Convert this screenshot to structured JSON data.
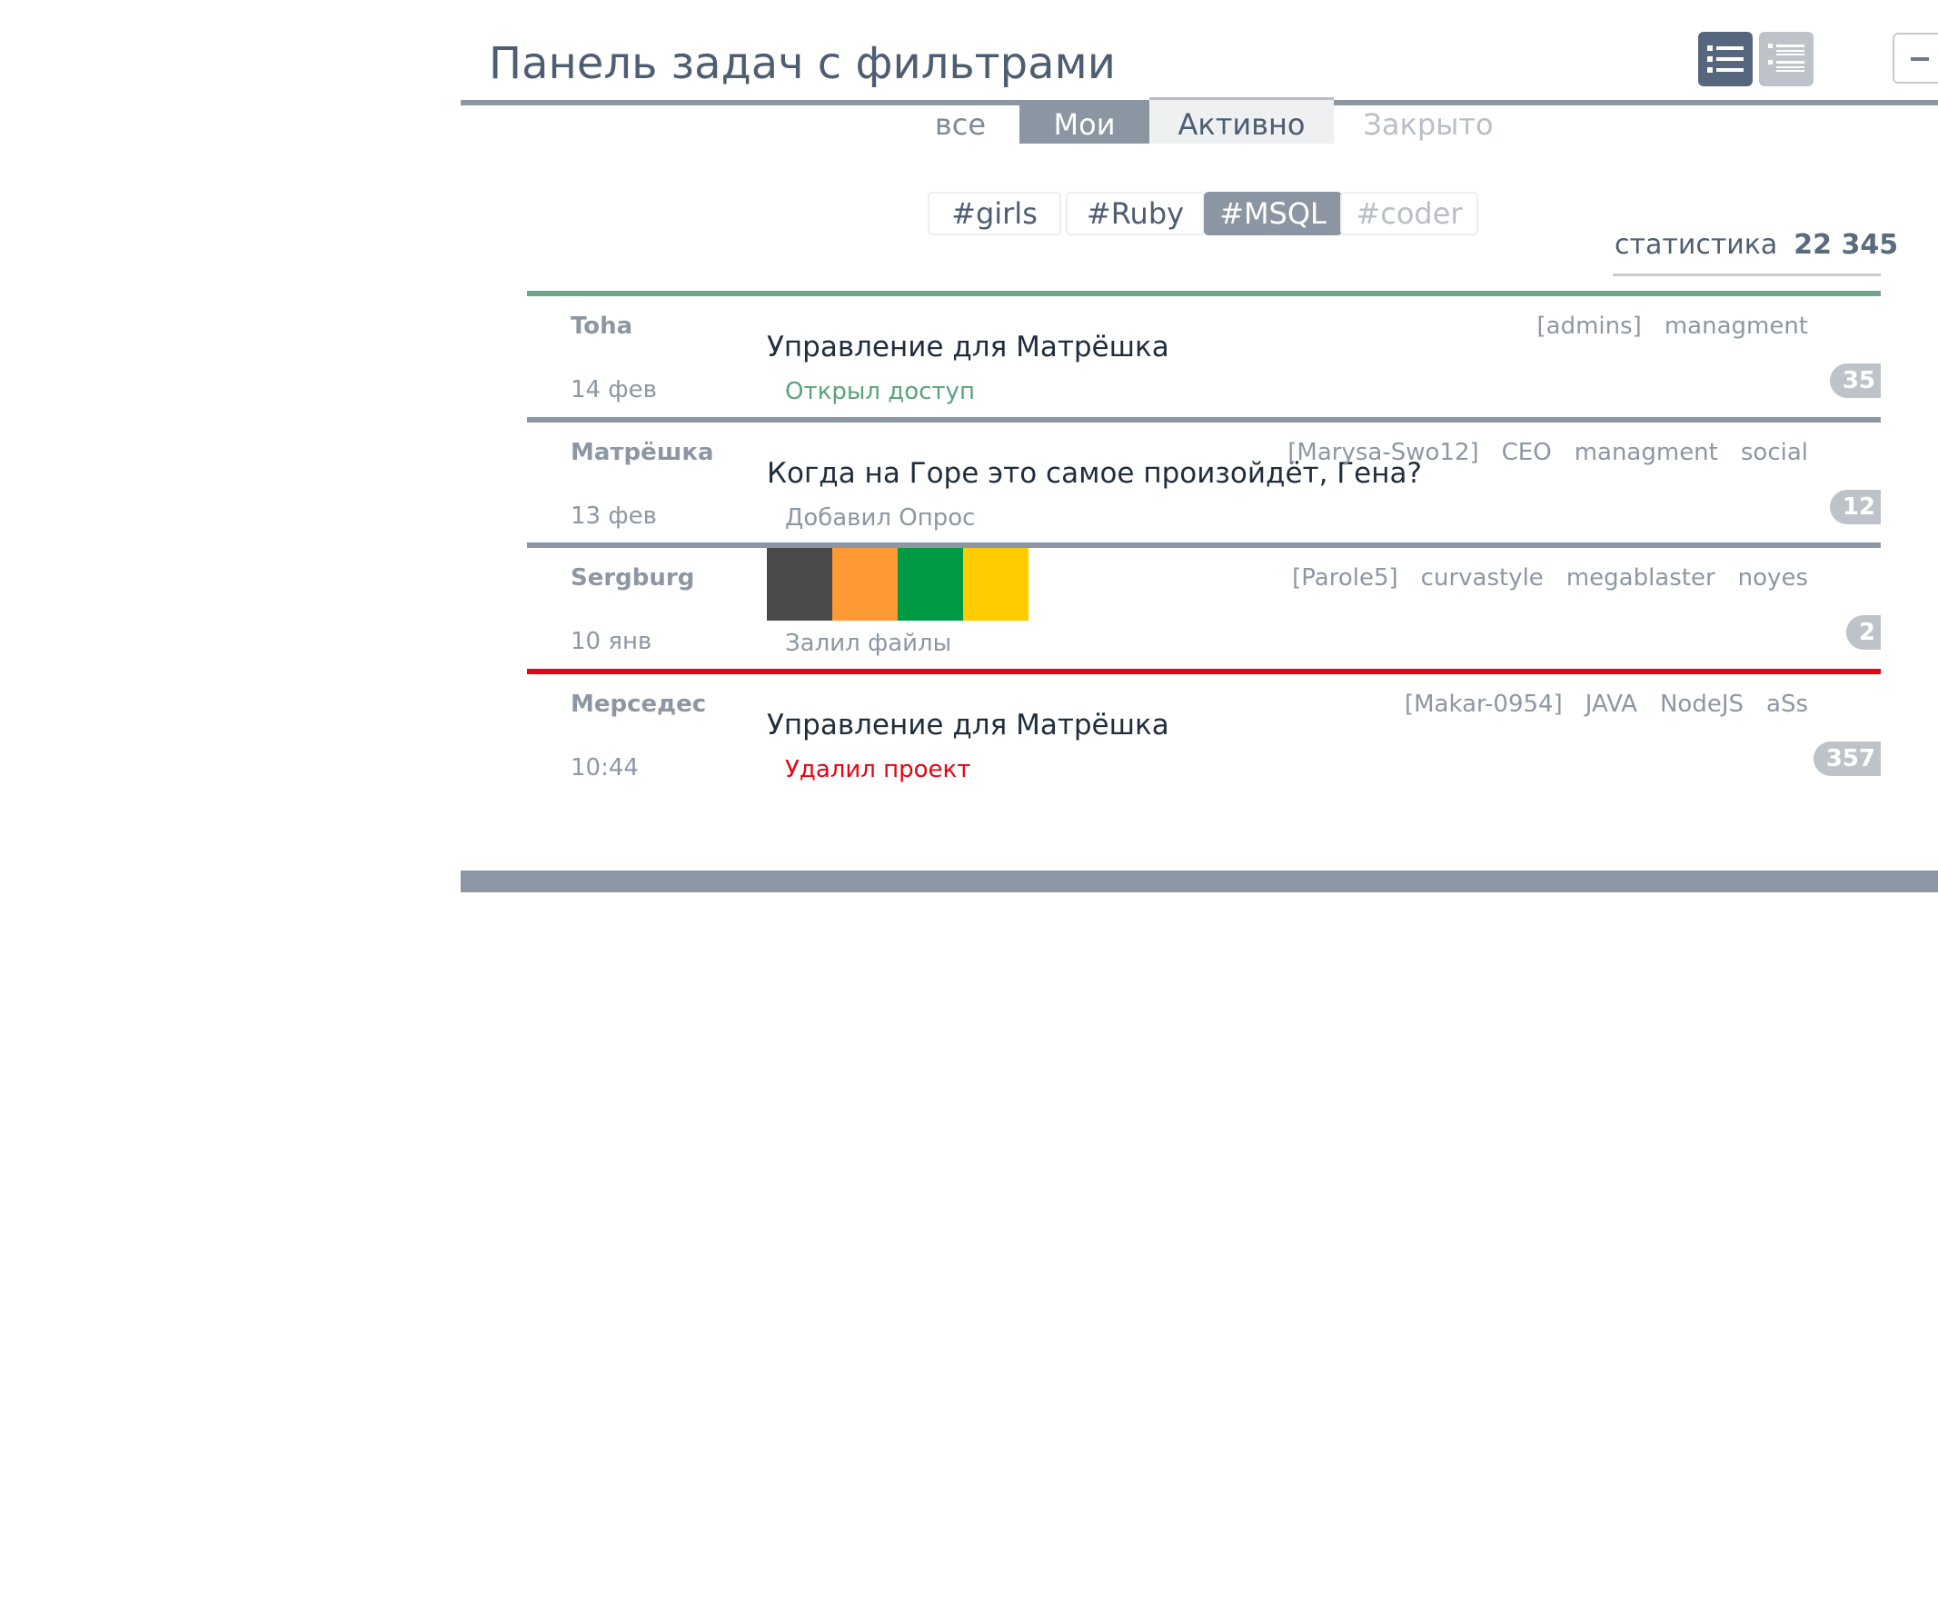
{
  "header": {
    "title": "Панель задач с фильтрами",
    "icons": {
      "list_view": "list-icon",
      "detail_view": "detail-list-icon",
      "minimize": "minus-icon"
    }
  },
  "status_tabs": [
    {
      "label": "все",
      "state": "default"
    },
    {
      "label": "Мои",
      "state": "selected"
    },
    {
      "label": "Активно",
      "state": "highlighted"
    },
    {
      "label": "Закрыто",
      "state": "disabled"
    }
  ],
  "hashtags": [
    {
      "label": "#girls",
      "state": "default"
    },
    {
      "label": "#Ruby",
      "state": "default"
    },
    {
      "label": "#MSQL",
      "state": "selected"
    },
    {
      "label": "#coder",
      "state": "disabled"
    }
  ],
  "stats": {
    "label": "статистика",
    "value": "22 345"
  },
  "tasks": [
    {
      "author": "Toha",
      "date": "14 фев",
      "title": "Управление для Матрёшка",
      "action": "Открыл доступ",
      "action_color": "#5aa27c",
      "line_color": "#6aa88a",
      "tags": [
        "[admins]",
        "managment"
      ],
      "count": "35"
    },
    {
      "author": "Матрёшка",
      "date": "13 фев",
      "title": "Когда на Горе это самое произойдёт, Гена?",
      "action": "Добавил Опрос",
      "action_color": "#8d97a3",
      "line_color": "#8d97a3",
      "tags": [
        "[Marysa-Swo12]",
        "CEO",
        "managment",
        "social"
      ],
      "count": "12"
    },
    {
      "author": "Sergburg",
      "date": "10 янв",
      "title": "",
      "action": "Залил файлы",
      "action_color": "#8d97a3",
      "line_color": "#8d97a3",
      "swatches": [
        "#4a4a4a",
        "#ff9933",
        "#009944",
        "#ffcc00"
      ],
      "tags": [
        "[Parole5]",
        "curvastyle",
        "megablaster",
        "noyes"
      ],
      "count": "2"
    },
    {
      "author": "Мерседес",
      "date": "10:44",
      "title": "Управление для Матрёшка",
      "action": "Удалил проект",
      "action_color": "#e30613",
      "line_color": "#e30613",
      "tags": [
        "[Makar-0954]",
        "JAVA",
        "NodeJS",
        "aSs"
      ],
      "count": "357"
    }
  ]
}
